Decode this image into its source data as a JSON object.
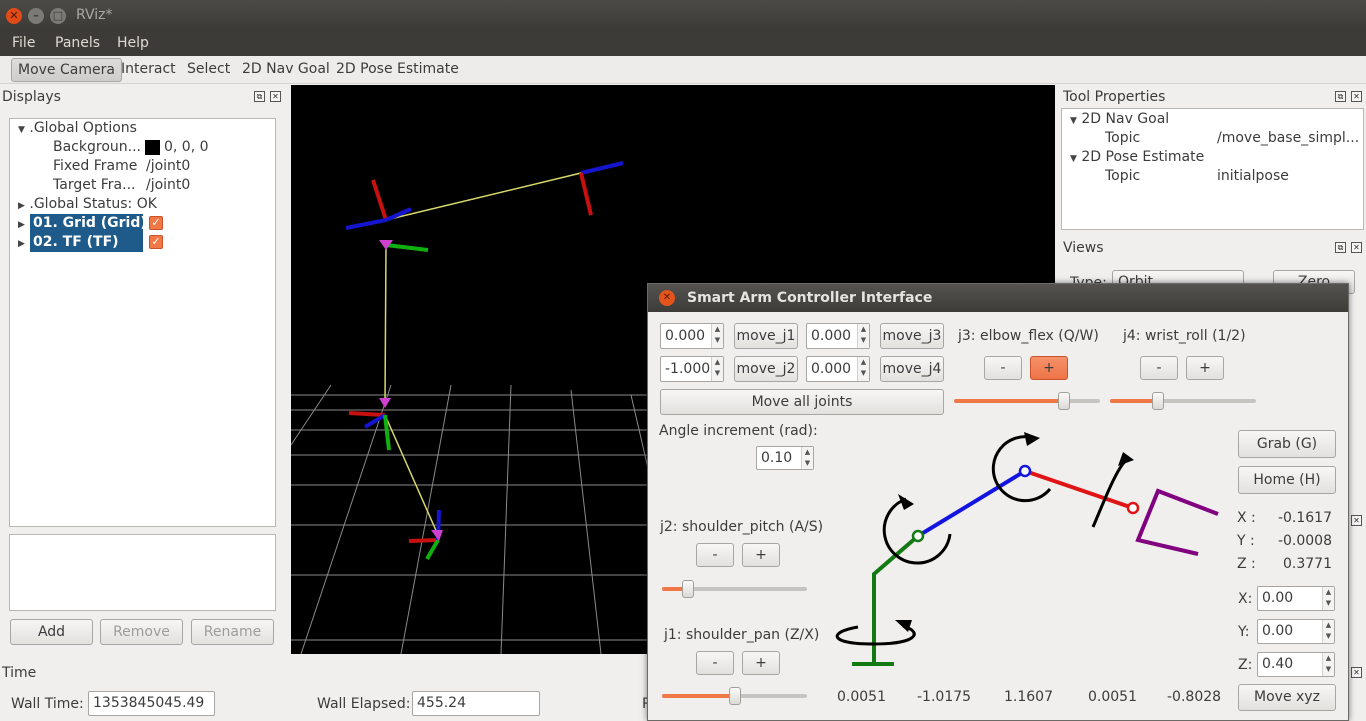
{
  "window": {
    "title": "RViz*"
  },
  "menu": {
    "file": "File",
    "panels": "Panels",
    "help": "Help"
  },
  "toolbar": {
    "move_camera": "Move Camera",
    "interact": "Interact",
    "select": "Select",
    "nav_goal": "2D Nav Goal",
    "pose_estimate": "2D Pose Estimate"
  },
  "displays": {
    "title": "Displays",
    "global_options": ".Global Options",
    "background_label": "Backgroun...",
    "background_value": "0, 0, 0",
    "fixed_frame_label": "Fixed Frame",
    "fixed_frame_value": "/joint0",
    "target_frame_label": "Target Fra...",
    "target_frame_value": "/joint0",
    "global_status": ".Global Status: OK",
    "grid": "01. Grid (Grid)",
    "tf": "02. TF (TF)",
    "add": "Add",
    "remove": "Remove",
    "rename": "Rename"
  },
  "tool_properties": {
    "title": "Tool Properties",
    "nav_goal": "2D Nav Goal",
    "nav_topic_label": "Topic",
    "nav_topic_value": "/move_base_simpl...",
    "pose_estimate": "2D Pose Estimate",
    "pose_topic_label": "Topic",
    "pose_topic_value": "initialpose"
  },
  "views": {
    "title": "Views",
    "type_label": "Type:",
    "type_value": "Orbit",
    "zero": "Zero"
  },
  "time": {
    "title": "Time",
    "wall_time_label": "Wall Time:",
    "wall_time": "1353845045.49",
    "wall_elapsed_label": "Wall Elapsed:",
    "wall_elapsed": "455.24",
    "cut_label": "R"
  },
  "dialog": {
    "title": "Smart Arm Controller Interface",
    "j1_value": "0.000",
    "move_j1": "move_j1",
    "j3_value": "0.000",
    "move_j3": "move_j3",
    "j2_value": "-1.000",
    "move_j2": "move_j2",
    "j4_value": "0.000",
    "move_j4": "move_j4",
    "move_all": "Move all joints",
    "j3_label": "j3: elbow_flex (Q/W)",
    "j4_label": "j4: wrist_roll (1/2)",
    "minus": "-",
    "plus": "+",
    "angle_label": "Angle increment (rad):",
    "angle_value": "0.10",
    "j2_label": "j2: shoulder_pitch (A/S)",
    "j1_label": "j1: shoulder_pan (Z/X)",
    "grab": "Grab (G)",
    "home": "Home (H)",
    "x_label": "X :",
    "x_value": "-0.1617",
    "y_label": "Y :",
    "y_value": "-0.0008",
    "z_label": "Z :",
    "z_value": "0.3771",
    "x_in_label": "X:",
    "x_in": "0.00",
    "y_in_label": "Y:",
    "y_in": "0.00",
    "z_in_label": "Z:",
    "z_in": "0.40",
    "move_xyz": "Move xyz",
    "readouts": [
      "0.0051",
      "-1.0175",
      "1.1607",
      "0.0051",
      "-0.8028"
    ],
    "sliders": {
      "j3": 0.75,
      "j4": 0.33,
      "j2": 0.18,
      "j1": 0.5
    }
  },
  "colors": {
    "accent": "#f07746",
    "selection": "#1e5a8a",
    "viewport": "#000000"
  }
}
